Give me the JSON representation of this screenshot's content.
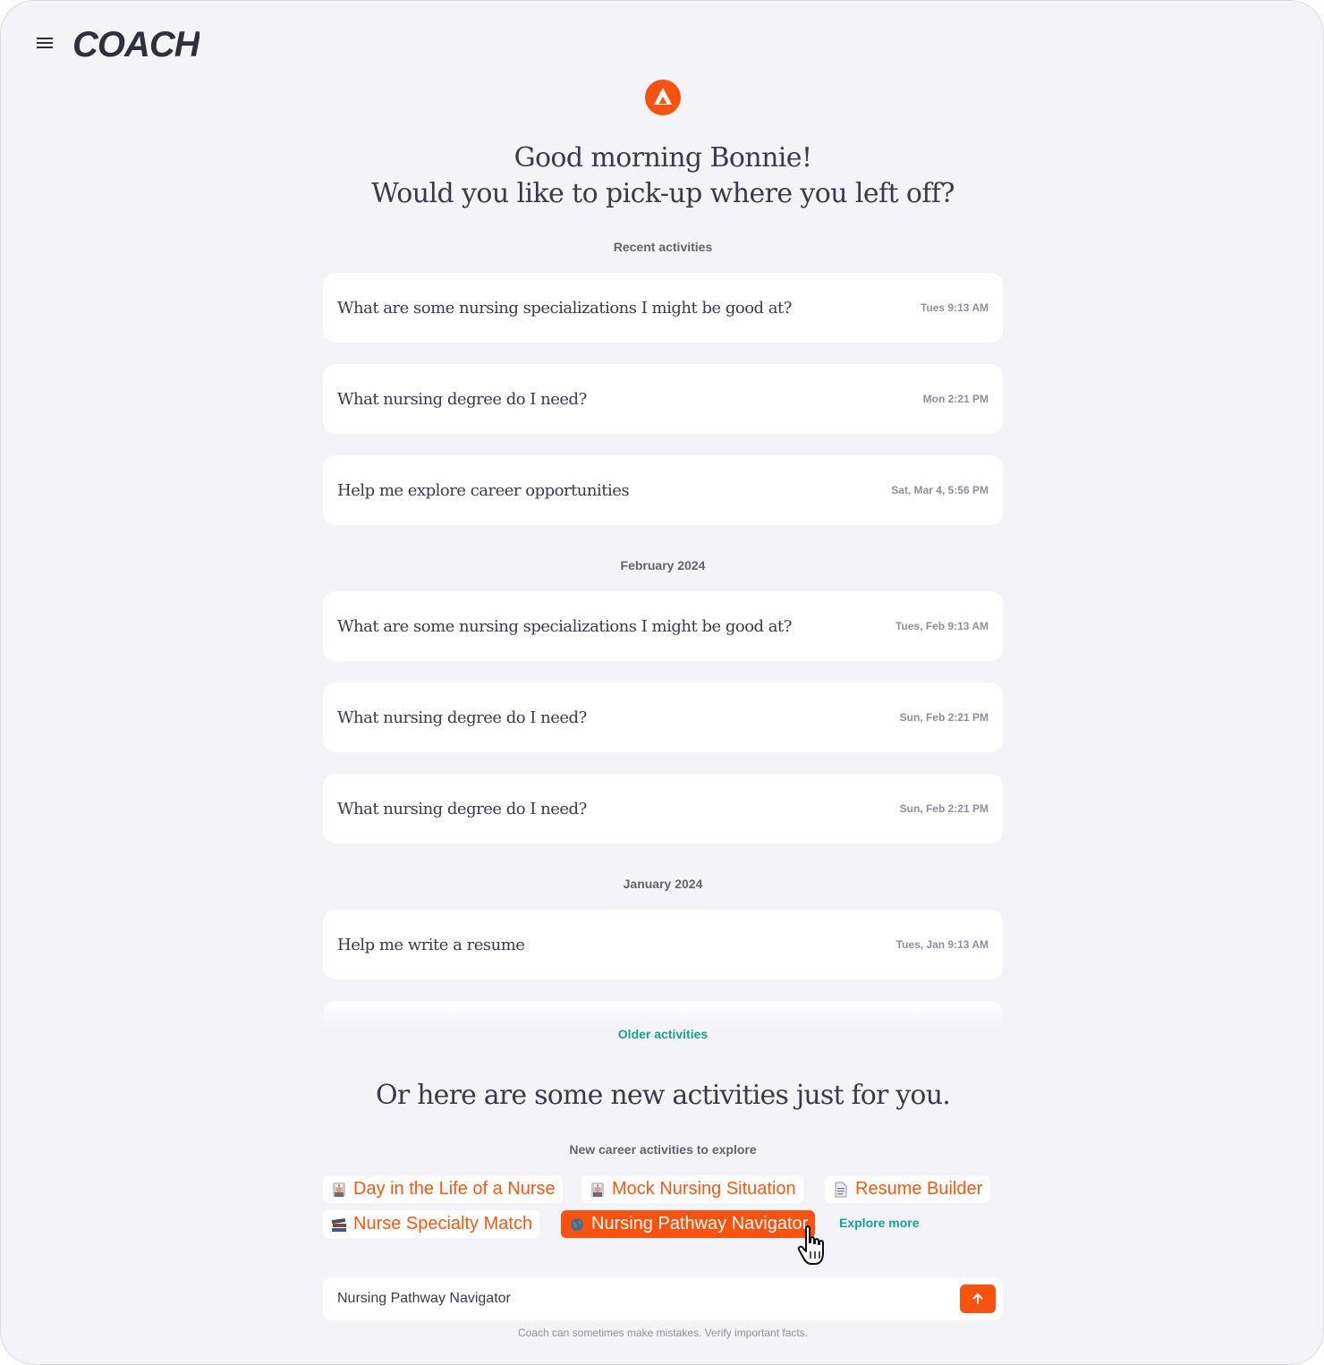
{
  "app": {
    "name": "COACH"
  },
  "greeting": {
    "line1": "Good morning Bonnie!",
    "line2": "Would you like to pick-up where you left off?"
  },
  "recent": {
    "label": "Recent activities",
    "items": [
      {
        "question": "What are some nursing specializations I might be good at?",
        "time": "Tues 9:13 AM"
      },
      {
        "question": "What nursing degree do I need?",
        "time": "Mon 2:21 PM"
      },
      {
        "question": "Help me explore career opportunities",
        "time": "Sat, Mar 4, 5:56 PM"
      }
    ]
  },
  "february": {
    "label": "February 2024",
    "items": [
      {
        "question": "What are some nursing specializations I might be good at?",
        "time": "Tues, Feb 9:13 AM"
      },
      {
        "question": "What nursing degree do I need?",
        "time": "Sun, Feb 2:21 PM"
      },
      {
        "question": "What nursing degree do I need?",
        "time": "Sun, Feb 2:21 PM"
      }
    ]
  },
  "january": {
    "label": "January 2024",
    "items": [
      {
        "question": "Help me write a resume",
        "time": "Tues, Jan 9:13 AM"
      }
    ]
  },
  "older_activities_label": "Older activities",
  "new_activities": {
    "headline": "Or here are some new activities just for you.",
    "label": "New career activities to explore",
    "chips": [
      {
        "label": "Day in the Life of a Nurse",
        "icon": "nurse-icon"
      },
      {
        "label": "Mock Nursing Situation",
        "icon": "nurse-icon"
      },
      {
        "label": "Resume Builder",
        "icon": "document-icon"
      },
      {
        "label": "Nurse Specialty Match",
        "icon": "books-icon"
      },
      {
        "label": "Nursing Pathway Navigator",
        "icon": "globe-icon",
        "selected": true
      }
    ],
    "explore_more": "Explore more"
  },
  "composer": {
    "value": "Nursing Pathway Navigator",
    "send_icon": "arrow-up-icon"
  },
  "disclaimer": "Coach can sometimes make mistakes. Verify important facts.",
  "colors": {
    "accent": "#f8520f",
    "link": "#14a38a",
    "background": "#f4f4f8",
    "text": "#3a3a4c"
  }
}
